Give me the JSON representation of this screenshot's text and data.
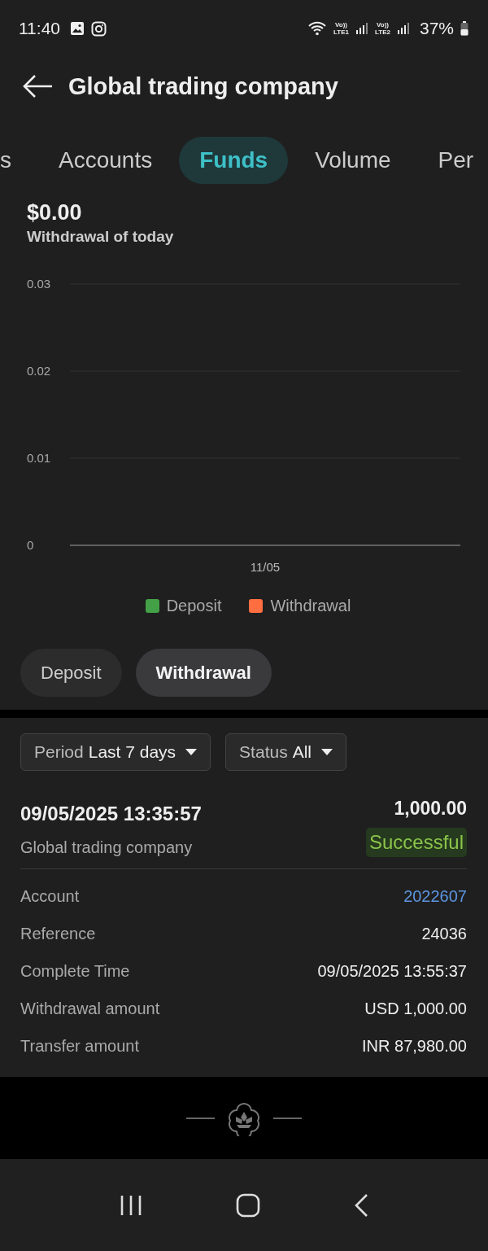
{
  "status_bar": {
    "time": "11:40",
    "sims": [
      {
        "top": "Vo))",
        "bottom": "LTE1"
      },
      {
        "top": "Vo))",
        "bottom": "LTE2"
      }
    ],
    "battery": "37%"
  },
  "header": {
    "title": "Global trading company"
  },
  "tabs": [
    {
      "label": "s",
      "selected": false
    },
    {
      "label": "Accounts",
      "selected": false
    },
    {
      "label": "Funds",
      "selected": true
    },
    {
      "label": "Volume",
      "selected": false
    },
    {
      "label": "Per",
      "selected": false
    }
  ],
  "summary": {
    "amount": "$0.00",
    "caption": "Withdrawal of today"
  },
  "chart": {
    "chart_data": {
      "type": "bar",
      "categories": [
        "11/05"
      ],
      "series": [
        {
          "name": "Deposit",
          "color": "#43a047",
          "values": [
            0
          ]
        },
        {
          "name": "Withdrawal",
          "color": "#ff6e40",
          "values": [
            0
          ]
        }
      ],
      "ylim": [
        0,
        0.03
      ],
      "yticks": [
        0,
        0.01,
        0.02,
        0.03
      ]
    }
  },
  "toggle": [
    {
      "label": "Deposit",
      "selected": false
    },
    {
      "label": "Withdrawal",
      "selected": true
    }
  ],
  "filters": [
    {
      "label": "Period",
      "value": "Last 7 days"
    },
    {
      "label": "Status",
      "value": "All"
    }
  ],
  "transaction": {
    "datetime": "09/05/2025 13:35:57",
    "amount": "1,000.00",
    "company": "Global trading company",
    "status": "Successful",
    "details": [
      {
        "label": "Account",
        "value": "2022607",
        "kind": "link"
      },
      {
        "label": "Reference",
        "value": "24036",
        "kind": "text"
      },
      {
        "label": "Complete Time",
        "value": "09/05/2025 13:55:37",
        "kind": "text"
      },
      {
        "label": "Withdrawal amount",
        "value": "USD 1,000.00",
        "kind": "text"
      },
      {
        "label": "Transfer amount",
        "value": "INR 87,980.00",
        "kind": "text"
      }
    ]
  }
}
